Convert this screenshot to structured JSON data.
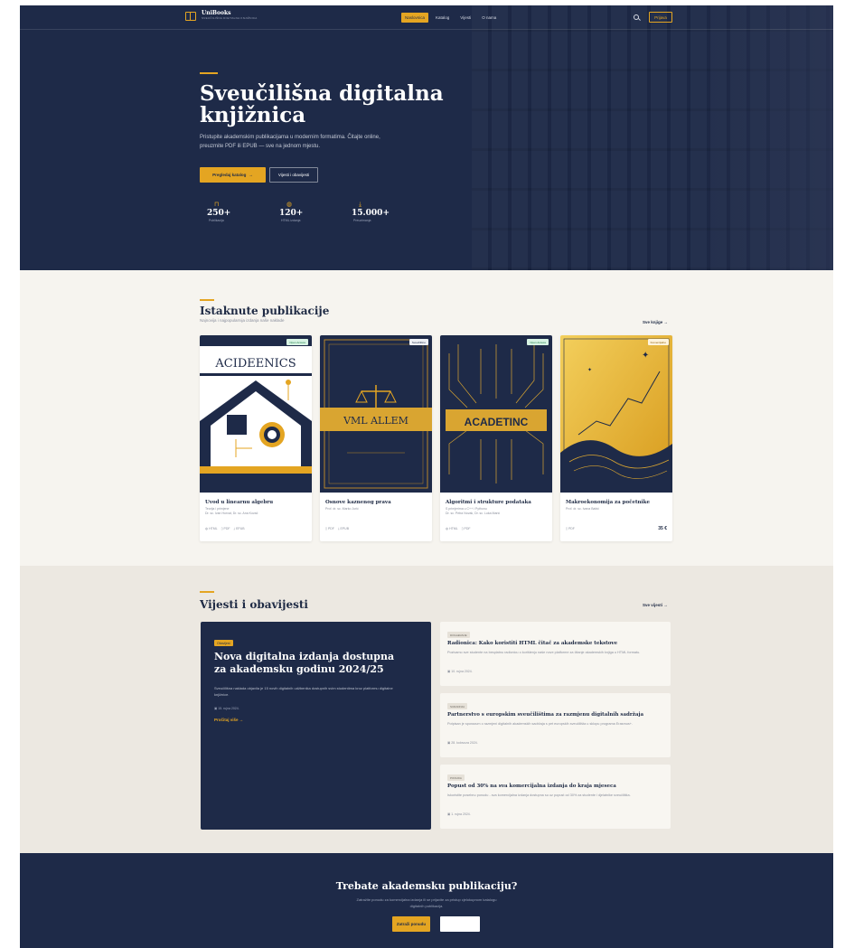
{
  "header": {
    "logo_name": "UniBooks",
    "logo_tag": "SVEUČILIŠNA DIGITALNA KNJIŽNICA",
    "nav": [
      "Naslovnica",
      "Katalog",
      "Vijesti",
      "O nama"
    ],
    "login_label": "Prijava"
  },
  "hero": {
    "title": "Sveučilišna digitalna knjižnica",
    "subtitle": "Pristupite akademskim publikacijama u modernim formatima. Čitajte online, preuzmite PDF ili EPUB — sve na jednom mjestu.",
    "primary_button": "Pregledaj katalog",
    "secondary_button": "Vijesti i obavijesti",
    "stats": [
      {
        "icon": "book-icon",
        "value": "250+",
        "label": "Publikacija"
      },
      {
        "icon": "globe-icon",
        "value": "120+",
        "label": "HTML izdanja"
      },
      {
        "icon": "download-icon",
        "value": "15.000+",
        "label": "Preuzimanja"
      }
    ]
  },
  "featured": {
    "title": "Istaknute publikacije",
    "subtitle": "Najnovija i najpopularnija izdanja naše naklade",
    "see_all": "Sve knjige",
    "books": [
      {
        "title": "Uvod u linearnu algebru",
        "sub1": "Teorija i primjene",
        "authors": "Dr. sc. Ivan Horvat, Dr. sc. Ana Kovač",
        "badge": "Open Access",
        "badge_type": "open",
        "cover_text": "ACIDEENICS",
        "formats": [
          "HTML",
          "PDF",
          "EPUB"
        ],
        "price": ""
      },
      {
        "title": "Osnove kaznenog prava",
        "sub1": "",
        "authors": "Prof. dr. sc. Marko Jurić",
        "badge": "Sveučilišno",
        "badge_type": "ac",
        "cover_text": "VML ALLEM",
        "formats": [
          "PDF",
          "EPUB"
        ],
        "price": ""
      },
      {
        "title": "Algoritmi i strukture podataka",
        "sub1": "S primjerima u C++ i Pythonu",
        "authors": "Dr. sc. Petra Novak, Dr. sc. Luka Marić",
        "badge": "Open Access",
        "badge_type": "open",
        "cover_text": "ACADETINC",
        "formats": [
          "HTML",
          "PDF"
        ],
        "price": ""
      },
      {
        "title": "Makroekonomija za početnike",
        "sub1": "",
        "authors": "Prof. dr. sc. Ivana Babić",
        "badge": "Komercijalno",
        "badge_type": "com",
        "cover_text": "",
        "formats": [
          "PDF"
        ],
        "price": "35 €"
      }
    ]
  },
  "news": {
    "title": "Vijesti i obavijesti",
    "see_all": "Sve vijesti",
    "main": {
      "tag": "Obavijest",
      "title": "Nova digitalna izdanja dostupna za akademsku godinu 2024/25",
      "text": "Sveučilišna naklada objavila je 15 novih digitalnih udžbenika dostupnih svim studentima kroz platformu digitalne knjižnice.",
      "date": "15. rujna 2024.",
      "more": "Pročitaj više"
    },
    "items": [
      {
        "tag": "DOGAĐANJE",
        "title": "Radionica: Kako koristiti HTML čitač za akademske tekstove",
        "text": "Pozivamo sve studente na besplatnu radionicu o korištenju naše nove platforme za čitanje akademskih knjiga u HTML formatu.",
        "date": "10. rujna 2024."
      },
      {
        "tag": "SURADNJA",
        "title": "Partnerstvo s europskim sveučilištima za razmjenu digitalnih sadržaja",
        "text": "Potpisan je sporazum o razmjeni digitalnih akademskih sadržaja s pet europskih sveučilišta u sklopu programa Erasmus+.",
        "date": "28. kolovoza 2024."
      },
      {
        "tag": "PONUDA",
        "title": "Popust od 30% na sva komercijalna izdanja do kraja mjeseca",
        "text": "Iskoristite posebnu ponudu - sva komercijalna izdanja dostupna su uz popust od 30% za studente i djelatnike sveučilišta.",
        "date": "1. rujna 2024."
      }
    ]
  },
  "cta": {
    "title": "Trebate akademsku publikaciju?",
    "text": "Zatražite ponudu za komercijalna izdanja ili se prijavite za pristup cjelokupnom katalogu digitalnih publikacija.",
    "button": "Zatraži ponudu"
  },
  "colors": {
    "navy": "#1e2a48",
    "gold": "#e4a522",
    "cream": "#f6f4ef"
  }
}
